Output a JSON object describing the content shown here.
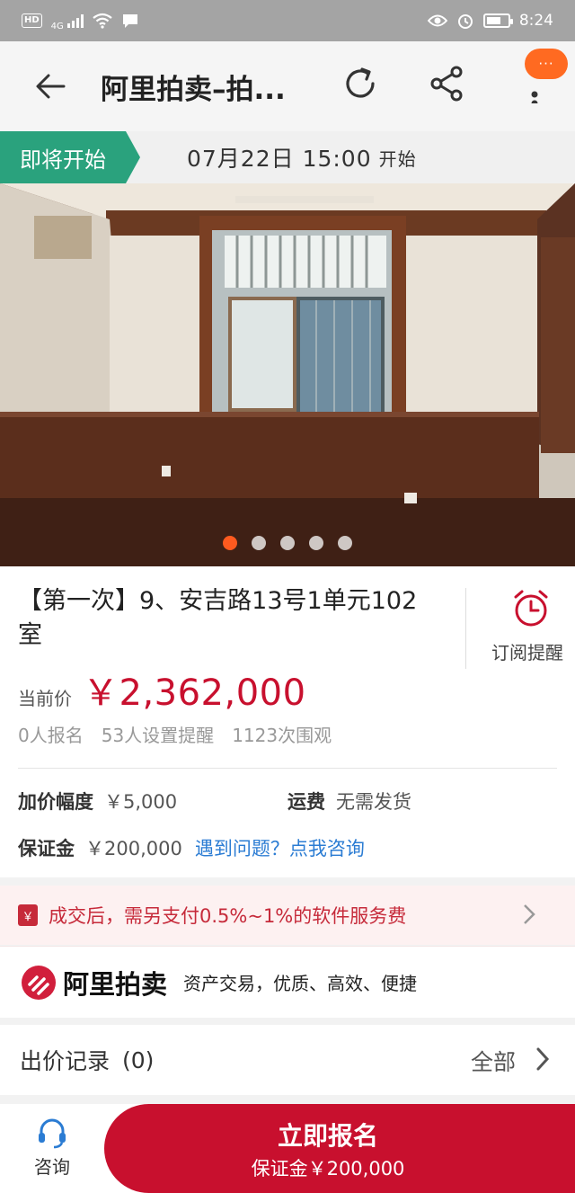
{
  "status_bar": {
    "left_badge": "HD",
    "network": "4G",
    "time": "8:24"
  },
  "nav": {
    "title": "阿里拍卖–拍...",
    "more_badge": "···"
  },
  "start": {
    "tag": "即将开始",
    "datetime": "07月22日 15:00",
    "suffix": "开始"
  },
  "gallery": {
    "total": 5,
    "active_index": 1
  },
  "item": {
    "title": "【第一次】9、安吉路13号1单元102室",
    "subscribe_label": "订阅提醒",
    "price_label": "当前价",
    "price_value": "￥2,362,000",
    "stats": {
      "signups": "0人报名",
      "reminders": "53人设置提醒",
      "views": "1123次围观"
    },
    "increment_label": "加价幅度",
    "increment_value": "￥5,000",
    "shipping_label": "运费",
    "shipping_value": "无需发货",
    "deposit_label": "保证金",
    "deposit_value": "￥200,000",
    "help_link": "遇到问题？点我咨询"
  },
  "fee": {
    "icon_text": "￥",
    "text": "成交后，需另支付0.5%~1%的软件服务费"
  },
  "brand": {
    "name": "阿里拍卖",
    "slogan": "资产交易，优质、高效、便捷"
  },
  "bids": {
    "title": "出价记录",
    "count": "(0)",
    "all": "全部"
  },
  "bottom": {
    "consult_label": "咨询",
    "signup_title": "立即报名",
    "signup_sub": "保证金￥200,000"
  },
  "colors": {
    "accent_red": "#c8102e",
    "tag_green": "#2aa27d",
    "link_blue": "#2b7cd3",
    "badge_orange": "#ff6a21"
  }
}
